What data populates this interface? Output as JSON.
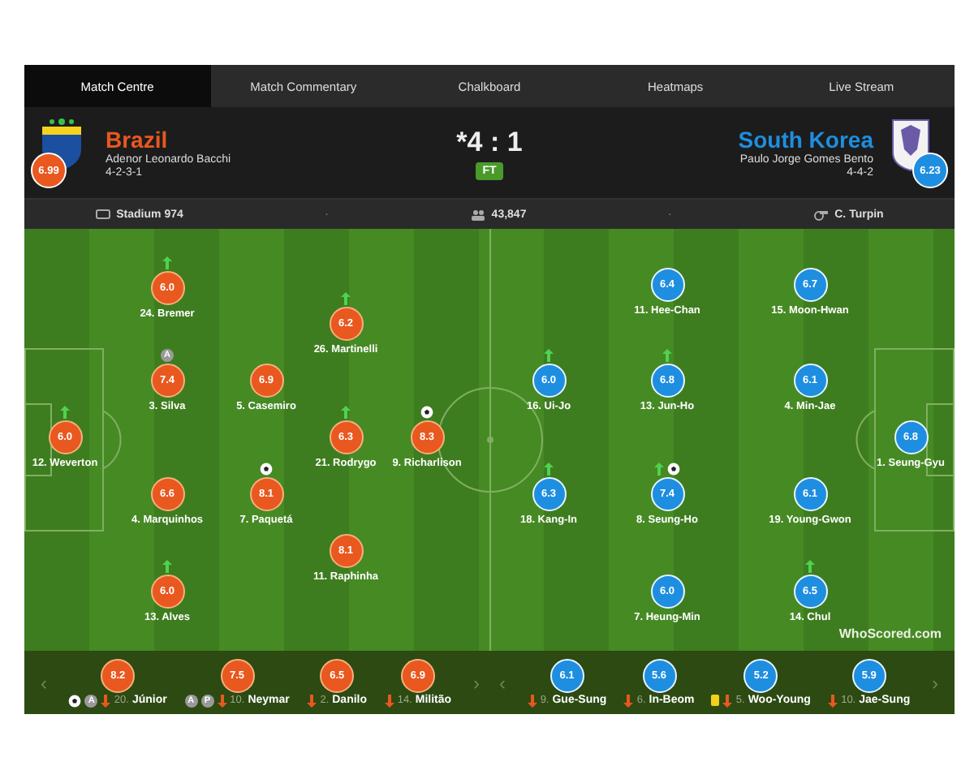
{
  "tabs": [
    {
      "label": "Match Centre",
      "selected": true
    },
    {
      "label": "Match Commentary",
      "selected": false
    },
    {
      "label": "Chalkboard",
      "selected": false
    },
    {
      "label": "Heatmaps",
      "selected": false
    },
    {
      "label": "Live Stream",
      "selected": false
    }
  ],
  "home": {
    "name": "Brazil",
    "manager": "Adenor Leonardo Bacchi",
    "formation": "4-2-3-1",
    "rating": "6.99"
  },
  "score": {
    "text": "*4 : 1",
    "status": "FT"
  },
  "away": {
    "name": "South Korea",
    "manager": "Paulo Jorge Gomes Bento",
    "formation": "4-4-2",
    "rating": "6.23"
  },
  "info": [
    {
      "kind": "stadium",
      "text": "Stadium 974"
    },
    {
      "kind": "separator",
      "text": "·"
    },
    {
      "kind": "attendance",
      "text": "43,847"
    },
    {
      "kind": "separator",
      "text": "·"
    },
    {
      "kind": "referee",
      "text": "C. Turpin"
    }
  ],
  "home_players": [
    {
      "name": "12. Weverton",
      "rating": "6.0",
      "events": [
        {
          "kind": "subbed_off"
        }
      ]
    },
    {
      "name": "24. Bremer",
      "rating": "6.0",
      "events": [
        {
          "kind": "subbed_off"
        }
      ]
    },
    {
      "name": "3. Silva",
      "rating": "7.4",
      "events": [
        {
          "kind": "captain",
          "label": "A"
        }
      ]
    },
    {
      "name": "4. Marquinhos",
      "rating": "6.6"
    },
    {
      "name": "13. Alves",
      "rating": "6.0",
      "events": [
        {
          "kind": "subbed_off"
        }
      ]
    },
    {
      "name": "5. Casemiro",
      "rating": "6.9"
    },
    {
      "name": "7. Paquetá",
      "rating": "8.1",
      "events": [
        {
          "kind": "goal"
        }
      ]
    },
    {
      "name": "26. Martinelli",
      "rating": "6.2",
      "events": [
        {
          "kind": "subbed_off"
        }
      ]
    },
    {
      "name": "21. Rodrygo",
      "rating": "6.3",
      "events": [
        {
          "kind": "subbed_off"
        }
      ]
    },
    {
      "name": "11. Raphinha",
      "rating": "8.1"
    },
    {
      "name": "9. Richarlison",
      "rating": "8.3",
      "events": [
        {
          "kind": "goal"
        }
      ]
    }
  ],
  "away_players": [
    {
      "name": "11. Hee-Chan",
      "rating": "6.4"
    },
    {
      "name": "15. Moon-Hwan",
      "rating": "6.7"
    },
    {
      "name": "16. Ui-Jo",
      "rating": "6.0",
      "events": [
        {
          "kind": "subbed_off"
        }
      ]
    },
    {
      "name": "13. Jun-Ho",
      "rating": "6.8",
      "events": [
        {
          "kind": "subbed_off"
        }
      ]
    },
    {
      "name": "4. Min-Jae",
      "rating": "6.1"
    },
    {
      "name": "18. Kang-In",
      "rating": "6.3",
      "events": [
        {
          "kind": "subbed_off"
        }
      ]
    },
    {
      "name": "8. Seung-Ho",
      "rating": "7.4",
      "events": [
        {
          "kind": "subbed_off"
        },
        {
          "kind": "goal"
        }
      ]
    },
    {
      "name": "19. Young-Gwon",
      "rating": "6.1"
    },
    {
      "name": "7. Heung-Min",
      "rating": "6.0"
    },
    {
      "name": "14. Chul",
      "rating": "6.5",
      "events": [
        {
          "kind": "subbed_off"
        }
      ]
    },
    {
      "name": "1. Seung-Gyu",
      "rating": "6.8"
    }
  ],
  "logo": "WhoScored.com",
  "home_subs": [
    {
      "number": "20.",
      "name": "Júnior",
      "rating": "8.2",
      "events": [
        {
          "kind": "goal"
        },
        {
          "kind": "captain",
          "label": "A"
        },
        {
          "kind": "subbed_on"
        }
      ]
    },
    {
      "number": "10.",
      "name": "Neymar",
      "rating": "7.5",
      "events": [
        {
          "kind": "captain",
          "label": "A"
        },
        {
          "kind": "captain",
          "label": "P"
        },
        {
          "kind": "subbed_on"
        }
      ]
    },
    {
      "number": "2.",
      "name": "Danilo",
      "rating": "6.5",
      "events": [
        {
          "kind": "subbed_on"
        }
      ]
    },
    {
      "number": "14.",
      "name": "Militão",
      "rating": "6.9",
      "events": [
        {
          "kind": "subbed_on"
        }
      ]
    }
  ],
  "away_subs": [
    {
      "number": "9.",
      "name": "Gue-Sung",
      "rating": "6.1",
      "events": [
        {
          "kind": "subbed_on"
        }
      ]
    },
    {
      "number": "6.",
      "name": "In-Beom",
      "rating": "5.6",
      "events": [
        {
          "kind": "subbed_on"
        }
      ]
    },
    {
      "number": "5.",
      "name": "Woo-Young",
      "rating": "5.2",
      "events": [
        {
          "kind": "yellow_card"
        },
        {
          "kind": "subbed_on"
        }
      ]
    },
    {
      "number": "10.",
      "name": "Jae-Sung",
      "rating": "5.9",
      "events": [
        {
          "kind": "subbed_on"
        }
      ]
    }
  ],
  "pager": {
    "prev": "‹",
    "next": "›"
  }
}
